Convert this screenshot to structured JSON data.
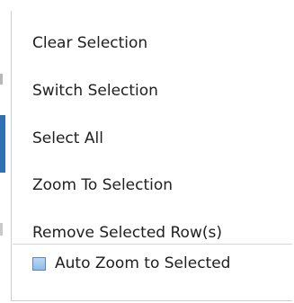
{
  "context_menu": {
    "items": [
      {
        "label": "Clear Selection"
      },
      {
        "label": "Switch Selection"
      },
      {
        "label": "Select All"
      },
      {
        "label": "Zoom To Selection"
      },
      {
        "label": "Remove Selected Row(s)"
      }
    ],
    "auto_zoom": {
      "label": "Auto Zoom to Selected",
      "checked": false
    }
  },
  "colors": {
    "checkbox_fill": "#a9cdf0",
    "checkbox_border": "#5a88b8",
    "underlay_accent": "#2f6fb3"
  }
}
